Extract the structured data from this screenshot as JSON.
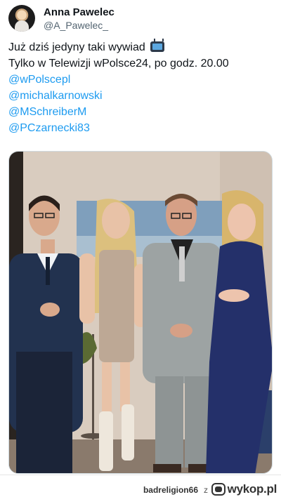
{
  "author": {
    "display_name": "Anna Pawelec",
    "handle": "@A_Pawelec_",
    "avatar_icon": "profile-avatar"
  },
  "tweet": {
    "line1": "Już dziś jedyny taki wywiad",
    "line1_icon": "tv-icon",
    "line2": "Tylko w Telewizji wPolsce24, po godz. 20.00",
    "mentions": [
      "@wPolscepl",
      "@michalkarnowski",
      "@MSchreiberM",
      "@PCzarnecki83"
    ]
  },
  "colors": {
    "link": "#1d9bf0",
    "text": "#0f1419",
    "muted": "#536471"
  },
  "footer": {
    "username": "badreligion66",
    "separator": "z",
    "brand": "wykop.pl"
  }
}
